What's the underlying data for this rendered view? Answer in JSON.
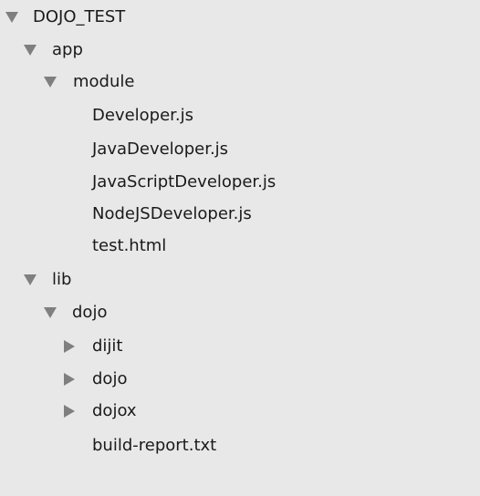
{
  "tree": {
    "root": {
      "label": "DOJO_TEST",
      "icon": "disclosure-expanded-icon"
    },
    "app": {
      "label": "app",
      "icon": "disclosure-expanded-icon"
    },
    "module": {
      "label": "module",
      "icon": "disclosure-expanded-icon"
    },
    "module_files": [
      {
        "label": "Developer.js"
      },
      {
        "label": "JavaDeveloper.js"
      },
      {
        "label": "JavaScriptDeveloper.js"
      },
      {
        "label": "NodeJSDeveloper.js"
      },
      {
        "label": "test.html"
      }
    ],
    "lib": {
      "label": "lib",
      "icon": "disclosure-expanded-icon"
    },
    "lib_dojo": {
      "label": "dojo",
      "icon": "disclosure-expanded-icon"
    },
    "lib_dojo_children": [
      {
        "label": "dijit",
        "icon": "disclosure-collapsed-icon"
      },
      {
        "label": "dojo",
        "icon": "disclosure-collapsed-icon"
      },
      {
        "label": "dojox",
        "icon": "disclosure-collapsed-icon"
      }
    ],
    "lib_dojo_files": [
      {
        "label": "build-report.txt"
      }
    ]
  },
  "colors": {
    "background": "#e8e8e8",
    "text": "#1a1a1a",
    "arrow": "#7f7f7f"
  }
}
